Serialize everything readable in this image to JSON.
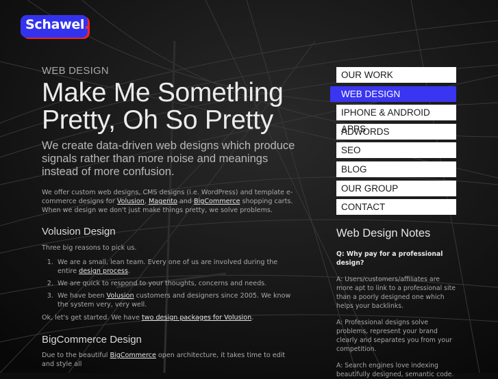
{
  "logo": {
    "text": "Schawel",
    "dot": "."
  },
  "main": {
    "kicker": "WEB DESIGN",
    "headline_line1": "Make Me Something",
    "headline_line2": "Pretty, Oh So Pretty",
    "lead": "We create data-driven web designs which produce signals rather than more noise and meanings instead of more confusion.",
    "intro": {
      "t1": "We offer custom web designs, CMS designs (i.e. WordPress) and template e-commerce designs for ",
      "link1": "Volusion",
      "t2": ", ",
      "link2": "Magento",
      "t3": " and ",
      "link3": "BigCommerce",
      "t4": " shopping carts. When we design we don't just make things pretty, we solve problems."
    },
    "volusion": {
      "heading": "Volusion Design",
      "reasons_intro": "Three big reasons to pick us.",
      "reason1_text": "We are a small, lean team. Every one of us are involved during the entire ",
      "reason1_link": "design process",
      "reason1_end": ".",
      "reason2_text": "We are quick to respond to your thoughts, concerns and needs.",
      "reason3_text1": "We have been ",
      "reason3_link": "Volusion",
      "reason3_text2": " customers and designers since 2005. We know the system very, very well.",
      "start_text": "Ok, let's get started. We have ",
      "start_link": "two design packages for Volusion",
      "start_end": "."
    },
    "bigcommerce": {
      "heading": "BigCommerce Design",
      "text1": "Due to the beautiful ",
      "link": "BigCommerce",
      "text2": " open architecture, it takes time to edit and style all"
    }
  },
  "nav": {
    "items": [
      {
        "label": "OUR WORK"
      },
      {
        "label": "WEB DESIGN"
      },
      {
        "label": "IPHONE & ANDROID APPS"
      },
      {
        "label": "ADWORDS"
      },
      {
        "label": "SEO"
      },
      {
        "label": "BLOG"
      },
      {
        "label": "OUR GROUP"
      },
      {
        "label": "CONTACT"
      }
    ],
    "active_index": 1
  },
  "sidebar": {
    "title": "Web Design Notes",
    "question": "Q: Why pay for a professional design?",
    "answers": [
      "A: Users/customers/affiliates are more apt to link to a professional site than a poorly designed one which helps your backlinks.",
      "A: Professional designs solve problems, represent your brand clearly and separates you from your competition.",
      "A: Search engines love indexing beautifully designed, semantic code."
    ]
  },
  "colors": {
    "accent": "#3a35f0",
    "logo_bg": "#3333ee",
    "logo_dot": "#ff2b2b",
    "background": "#0d0d0d"
  }
}
